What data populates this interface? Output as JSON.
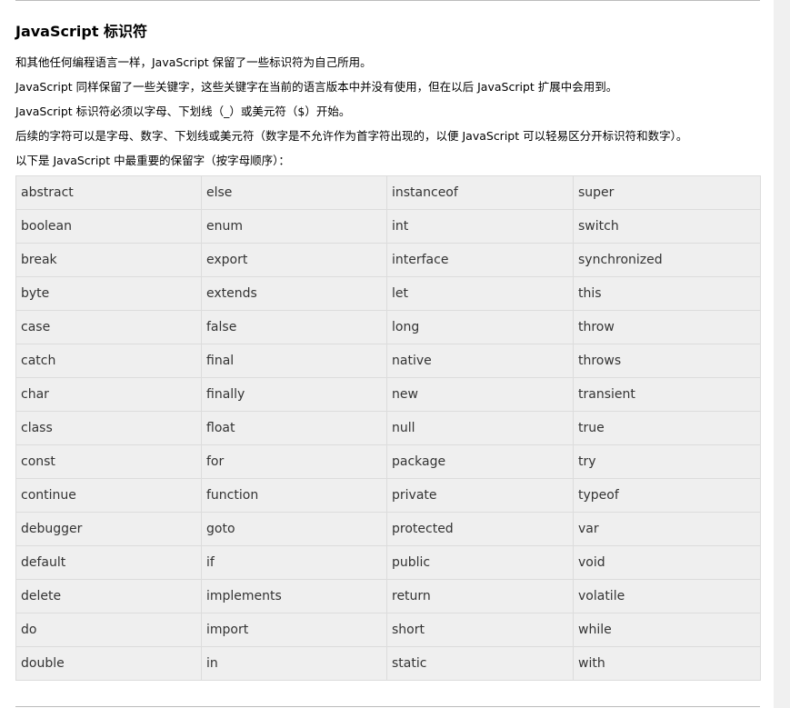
{
  "article": {
    "title": "JavaScript 标识符",
    "paragraphs": [
      "和其他任何编程语言一样，JavaScript 保留了一些标识符为自己所用。",
      "JavaScript 同样保留了一些关键字，这些关键字在当前的语言版本中并没有使用，但在以后 JavaScript 扩展中会用到。",
      "JavaScript 标识符必须以字母、下划线（_）或美元符（$）开始。",
      "后续的字符可以是字母、数字、下划线或美元符（数字是不允许作为首字符出现的，以便 JavaScript 可以轻易区分开标识符和数字）。",
      "以下是 JavaScript 中最重要的保留字（按字母顺序）："
    ]
  },
  "reserved_words_table": {
    "rows": [
      [
        "abstract",
        "else",
        "instanceof",
        "super"
      ],
      [
        "boolean",
        "enum",
        "int",
        "switch"
      ],
      [
        "break",
        "export",
        "interface",
        "synchronized"
      ],
      [
        "byte",
        "extends",
        "let",
        "this"
      ],
      [
        "case",
        "false",
        "long",
        "throw"
      ],
      [
        "catch",
        "final",
        "native",
        "throws"
      ],
      [
        "char",
        "finally",
        "new",
        "transient"
      ],
      [
        "class",
        "float",
        "null",
        "true"
      ],
      [
        "const",
        "for",
        "package",
        "try"
      ],
      [
        "continue",
        "function",
        "private",
        "typeof"
      ],
      [
        "debugger",
        "goto",
        "protected",
        "var"
      ],
      [
        "default",
        "if",
        "public",
        "void"
      ],
      [
        "delete",
        "implements",
        "return",
        "volatile"
      ],
      [
        "do",
        "import",
        "short",
        "while"
      ],
      [
        "double",
        "in",
        "static",
        "with"
      ]
    ]
  }
}
